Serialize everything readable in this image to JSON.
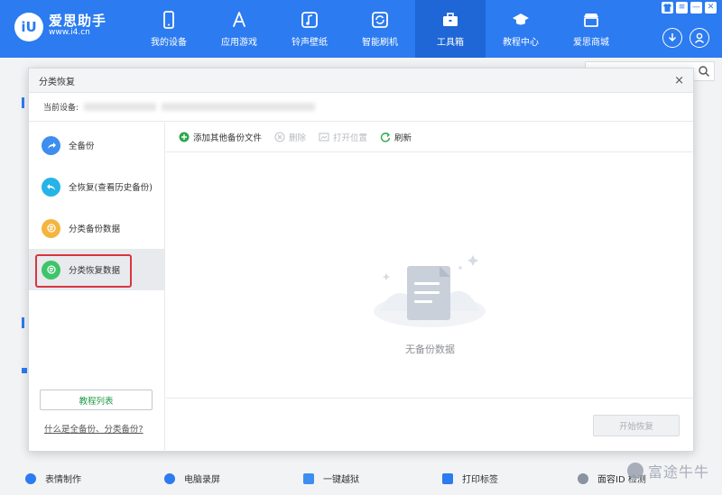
{
  "app": {
    "name": "爱思助手",
    "url": "www.i4.cn",
    "logo_mark": "iU"
  },
  "nav": [
    {
      "label": "我的设备",
      "icon": "phone-icon"
    },
    {
      "label": "应用游戏",
      "icon": "app-store-icon"
    },
    {
      "label": "铃声壁纸",
      "icon": "music-icon"
    },
    {
      "label": "智能刷机",
      "icon": "refresh-icon"
    },
    {
      "label": "工具箱",
      "icon": "toolbox-icon",
      "active": true
    },
    {
      "label": "教程中心",
      "icon": "graduation-cap-icon"
    },
    {
      "label": "爱思商城",
      "icon": "shop-icon"
    }
  ],
  "window_controls": [
    "shirt",
    "≡",
    "—",
    "✕"
  ],
  "background_tools": [
    {
      "label": "表情制作"
    },
    {
      "label": "电脑录屏"
    },
    {
      "label": "一键越狱"
    },
    {
      "label": "打印标签"
    },
    {
      "label": "面容ID 检测"
    }
  ],
  "watermark": "富途牛牛",
  "dialog": {
    "title": "分类恢复",
    "close": "×",
    "device_label": "当前设备:",
    "sidebar": [
      {
        "label": "全备份",
        "icon": "share-arrow-icon",
        "color": "#3d8ef0"
      },
      {
        "label": "全恢复(查看历史备份)",
        "icon": "undo-arrow-icon",
        "color": "#26b3e8"
      },
      {
        "label": "分类备份数据",
        "icon": "category-backup-icon",
        "color": "#f4b53f"
      },
      {
        "label": "分类恢复数据",
        "icon": "category-restore-icon",
        "color": "#3fc46a",
        "active": true
      }
    ],
    "tutorial_button": "教程列表",
    "help_link": "什么是全备份、分类备份?",
    "toolbar": {
      "add": "添加其他备份文件",
      "delete": "删除",
      "open_location": "打开位置",
      "refresh": "刷新"
    },
    "empty_text": "无备份数据",
    "start_button": "开始恢复"
  }
}
